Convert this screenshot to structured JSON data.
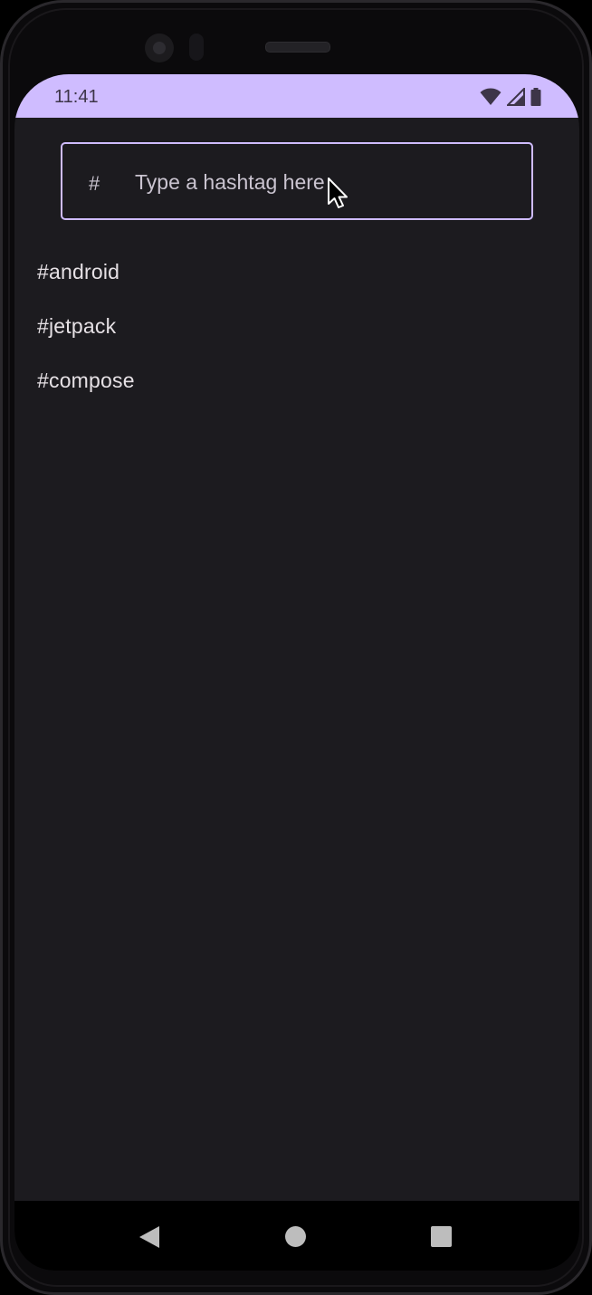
{
  "status_bar": {
    "time": "11:41",
    "icons": [
      "wifi-icon",
      "cell-signal-icon",
      "battery-icon"
    ],
    "background_color": "#cfbcff"
  },
  "search": {
    "prefix": "#",
    "placeholder": "Type a hashtag here",
    "value": "",
    "border_color": "#cfbcff"
  },
  "tags": [
    {
      "label": "#android"
    },
    {
      "label": "#jetpack"
    },
    {
      "label": "#compose"
    }
  ],
  "nav_bar": {
    "buttons": [
      "back-icon",
      "home-icon",
      "recents-icon"
    ]
  },
  "colors": {
    "screen_background": "#1c1b1f",
    "text_primary": "#e6e1e5",
    "text_secondary": "#cac4d0"
  }
}
